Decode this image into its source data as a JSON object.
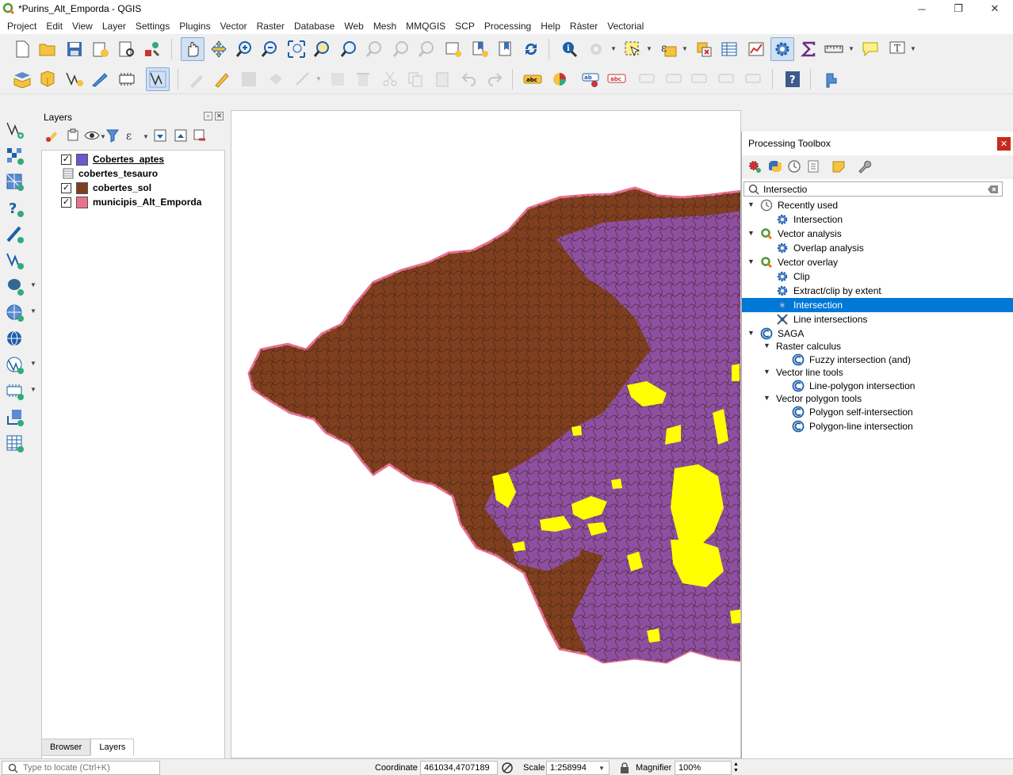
{
  "window": {
    "title": "*Purins_Alt_Emporda - QGIS"
  },
  "menus": [
    "Project",
    "Edit",
    "View",
    "Layer",
    "Settings",
    "Plugins",
    "Vector",
    "Raster",
    "Database",
    "Web",
    "Mesh",
    "MMQGIS",
    "SCP",
    "Processing",
    "Help",
    "Ràster",
    "Vectorial"
  ],
  "layers_panel": {
    "title": "Layers",
    "layers": [
      {
        "name": "Cobertes_aptes",
        "checked": true,
        "color": "#6a5acd",
        "selected": true
      },
      {
        "name": "cobertes_tesauro",
        "checked": null,
        "color": null
      },
      {
        "name": "cobertes_sol",
        "checked": true,
        "color": "#7f3f1f"
      },
      {
        "name": "municipis_Alt_Emporda",
        "checked": true,
        "color": "#e8728f"
      }
    ],
    "tabs": [
      "Browser",
      "Layers"
    ]
  },
  "toolbox": {
    "title": "Processing Toolbox",
    "search_value": "Intersectio",
    "tree": [
      {
        "label": "Recently used",
        "level": 0,
        "icon": "clock-icon",
        "expanded": true
      },
      {
        "label": "Intersection",
        "level": 1,
        "icon": "gear-icon"
      },
      {
        "label": "Vector analysis",
        "level": 0,
        "icon": "qgis-icon",
        "expanded": true
      },
      {
        "label": "Overlap analysis",
        "level": 1,
        "icon": "gear-icon"
      },
      {
        "label": "Vector overlay",
        "level": 0,
        "icon": "qgis-icon",
        "expanded": true
      },
      {
        "label": "Clip",
        "level": 1,
        "icon": "gear-icon"
      },
      {
        "label": "Extract/clip by extent",
        "level": 1,
        "icon": "gear-icon"
      },
      {
        "label": "Intersection",
        "level": 1,
        "icon": "gear-icon",
        "highlighted": true
      },
      {
        "label": "Line intersections",
        "level": 1,
        "icon": "line-intersect-icon"
      },
      {
        "label": "SAGA",
        "level": 0,
        "icon": "saga-icon",
        "expanded": true
      },
      {
        "label": "Raster calculus",
        "level": 1,
        "icon": null,
        "expanded": true
      },
      {
        "label": "Fuzzy intersection (and)",
        "level": 2,
        "icon": "saga-icon"
      },
      {
        "label": "Vector line tools",
        "level": 1,
        "icon": null,
        "expanded": true
      },
      {
        "label": "Line-polygon intersection",
        "level": 2,
        "icon": "saga-icon"
      },
      {
        "label": "Vector polygon tools",
        "level": 1,
        "icon": null,
        "expanded": true
      },
      {
        "label": "Polygon self-intersection",
        "level": 2,
        "icon": "saga-icon"
      },
      {
        "label": "Polygon-line intersection",
        "level": 2,
        "icon": "saga-icon"
      }
    ]
  },
  "statusbar": {
    "locate_placeholder": "Type to locate (Ctrl+K)",
    "coordinate_label": "Coordinate",
    "coordinate_value": "461034,4707189",
    "scale_label": "Scale",
    "scale_value": "1:258994",
    "magnifier_label": "Magnifier",
    "magnifier_value": "100%"
  },
  "colors": {
    "terrain": "#7f3f1f",
    "suitable": "#8e4fa0",
    "highlight": "#ffff00",
    "border": "#e8728f",
    "selection": "#0078d7"
  }
}
